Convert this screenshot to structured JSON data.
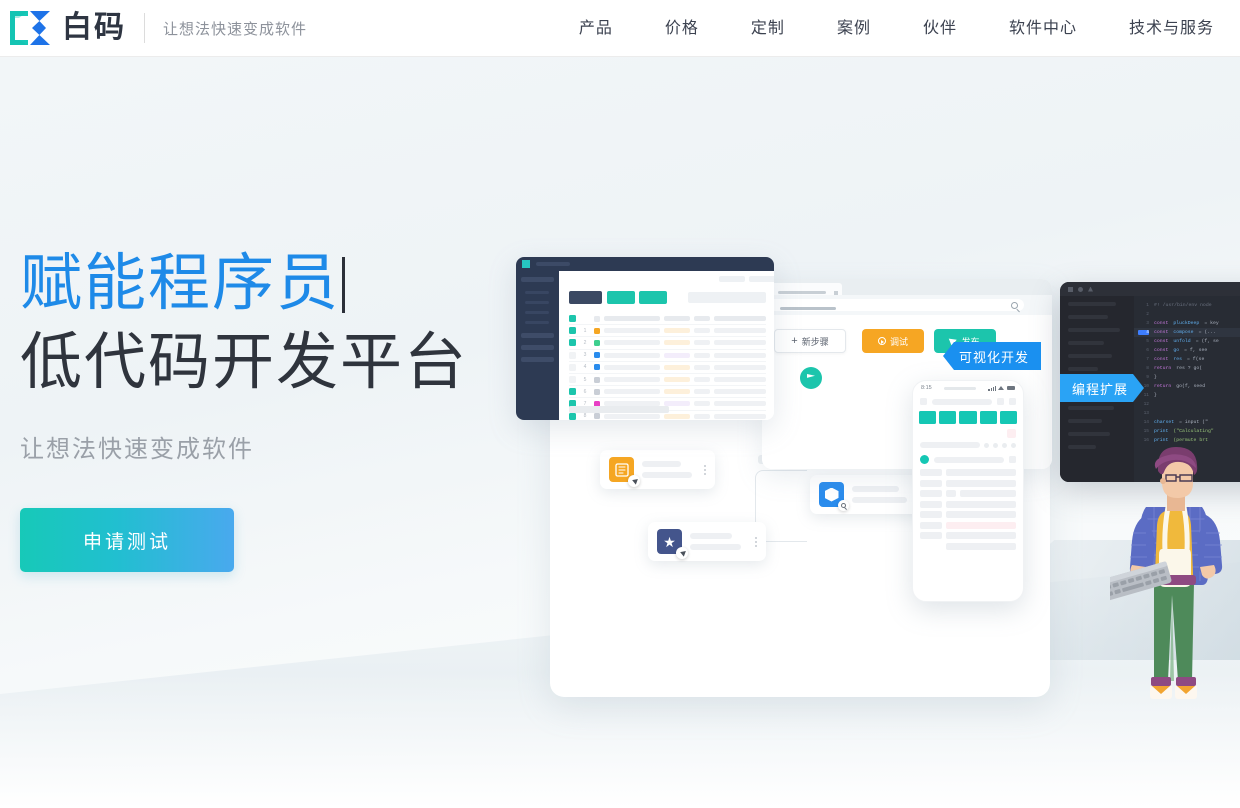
{
  "header": {
    "logo_text": "白码",
    "logo_icon": "bracket-k-logo-icon",
    "slogan": "让想法快速变成软件",
    "nav_items": [
      {
        "label": "产品",
        "name": "nav-product"
      },
      {
        "label": "价格",
        "name": "nav-pricing"
      },
      {
        "label": "定制",
        "name": "nav-custom"
      },
      {
        "label": "案例",
        "name": "nav-cases"
      },
      {
        "label": "伙伴",
        "name": "nav-partners"
      },
      {
        "label": "软件中心",
        "name": "nav-software-center"
      },
      {
        "label": "技术与服务",
        "name": "nav-tech-service"
      }
    ]
  },
  "hero": {
    "headline_typed": "赋能程序员",
    "headline_static": "低代码开发平台",
    "subtitle": "让想法快速变成软件",
    "cta_label": "申请测试",
    "accent_blue": "#1e8ae8",
    "headline_dark": "#2f343d",
    "cta_gradient_from": "#17c9b8",
    "cta_gradient_to": "#49a9ee"
  },
  "illustration": {
    "browser": {
      "new_step_label": "新步骤",
      "new_step_icon": "plus-icon",
      "debug_label": "调试",
      "debug_icon": "play-circle-icon",
      "debug_color": "#f6a623",
      "publish_label": "发布",
      "publish_icon": "send-icon",
      "publish_color": "#1cc5ac",
      "url_placeholder": "",
      "search_icon": "search-icon",
      "start_node_icon": "flag-icon"
    },
    "ribbons": [
      {
        "label": "可视化开发",
        "name": "ribbon-visual-dev",
        "color": "#1a90f0"
      },
      {
        "label": "编程扩展",
        "name": "ribbon-code-extend",
        "color": "#2aa3f5"
      }
    ],
    "flow_nodes": [
      {
        "name": "flow-node-green",
        "icon": "shape-icon",
        "color": "#3ecf8e",
        "badge": "magnifier-icon"
      },
      {
        "name": "flow-node-orange",
        "icon": "grid-icon",
        "color": "#f5a623",
        "badge": "cursor-icon"
      },
      {
        "name": "flow-node-blue",
        "icon": "cube-icon",
        "color": "#2a8ced",
        "badge": "magnifier-icon"
      },
      {
        "name": "flow-node-navy",
        "icon": "star-icon",
        "color": "#44558c",
        "badge": "cursor-icon"
      }
    ],
    "phone": {
      "status_time": "8:15",
      "signal_icon": "signal-icon",
      "wifi_icon": "wifi-icon",
      "battery_icon": "battery-icon",
      "tab_color": "#15c7b4"
    },
    "dashboard": {
      "sidebar_color": "#2d3a53",
      "accent_color": "#1cc5ac",
      "row_numbers": [
        "1",
        "2",
        "3",
        "4",
        "5",
        "6",
        "7",
        "8"
      ],
      "status_colors": [
        "#f5a623",
        "#3ecf8e",
        "#2a8ced",
        "#2a8ced",
        "#c9ced6",
        "#c9ced6",
        "#e83fc4",
        "#c9ced6"
      ]
    },
    "code_editor": {
      "theme": "dark",
      "active_line": "4",
      "lines": [
        {
          "num": "1",
          "tokens": [
            {
              "t": "#! /usr/bin/env node",
              "c": "t-cm"
            }
          ]
        },
        {
          "num": "2",
          "tokens": []
        },
        {
          "num": "3",
          "tokens": [
            {
              "t": "const",
              "c": "t-kw"
            },
            {
              "t": "pluckDeep",
              "c": "t-fn"
            },
            {
              "t": "= key",
              "c": "t-pl"
            }
          ]
        },
        {
          "num": "4",
          "tokens": [
            {
              "t": "const",
              "c": "t-kw"
            },
            {
              "t": "compose",
              "c": "t-fn"
            },
            {
              "t": "= (...",
              "c": "t-pl"
            }
          ]
        },
        {
          "num": "5",
          "tokens": [
            {
              "t": "const",
              "c": "t-kw"
            },
            {
              "t": "unfold",
              "c": "t-fn"
            },
            {
              "t": "= (f, se",
              "c": "t-pl"
            }
          ]
        },
        {
          "num": "6",
          "tokens": [
            {
              "t": "const",
              "c": "t-kw"
            },
            {
              "t": "go",
              "c": "t-fn"
            },
            {
              "t": "= f, see",
              "c": "t-pl"
            }
          ]
        },
        {
          "num": "7",
          "tokens": [
            {
              "t": "const",
              "c": "t-kw"
            },
            {
              "t": "res",
              "c": "t-fn"
            },
            {
              "t": "= f(se",
              "c": "t-pl"
            }
          ]
        },
        {
          "num": "8",
          "tokens": [
            {
              "t": "return",
              "c": "t-kw"
            },
            {
              "t": "res ? go(",
              "c": "t-pl"
            }
          ]
        },
        {
          "num": "9",
          "tokens": [
            {
              "t": "}",
              "c": "t-pl"
            }
          ]
        },
        {
          "num": "10",
          "tokens": [
            {
              "t": "return",
              "c": "t-kw"
            },
            {
              "t": "go(f, seed",
              "c": "t-pl"
            }
          ]
        },
        {
          "num": "11",
          "tokens": [
            {
              "t": "}",
              "c": "t-pl"
            }
          ]
        },
        {
          "num": "12",
          "tokens": []
        },
        {
          "num": "13",
          "tokens": []
        },
        {
          "num": "14",
          "tokens": [
            {
              "t": "charset",
              "c": "t-fn"
            },
            {
              "t": "= input (\"",
              "c": "t-pl"
            }
          ]
        },
        {
          "num": "15",
          "tokens": [
            {
              "t": "print",
              "c": "t-fn"
            },
            {
              "t": "(\"Calculating\"",
              "c": "t-str"
            }
          ]
        },
        {
          "num": "16",
          "tokens": [
            {
              "t": "print",
              "c": "t-fn"
            },
            {
              "t": "(permute brt",
              "c": "t-str"
            }
          ]
        }
      ]
    },
    "person": {
      "name": "developer-character",
      "hair_color": "#7a3d6e",
      "shirt_color": "#5b6cc4",
      "backpack_color": "#f0b93c",
      "pants_color": "#4e8a5a",
      "keyboard_color": "#a9aeb4"
    }
  }
}
